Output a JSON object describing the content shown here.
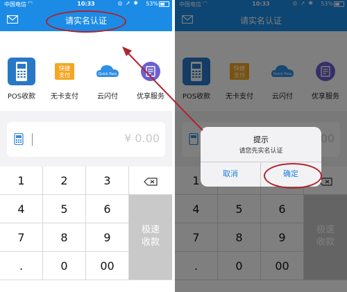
{
  "status_bar": {
    "carrier": "中国电信",
    "time": "10:33",
    "battery": "53%"
  },
  "nav": {
    "title": "请实名认证"
  },
  "tiles": [
    {
      "label": "POS收款",
      "icon": "pos-terminal-icon"
    },
    {
      "label": "无卡支付",
      "icon": "quick-pay-icon",
      "badge_line1": "快捷",
      "badge_line2": "支付"
    },
    {
      "label": "云闪付",
      "icon": "quickpass-cloud-icon",
      "badge_text": "Quick Pass"
    },
    {
      "label": "优享服务",
      "icon": "service-list-icon"
    }
  ],
  "amount": {
    "value": "¥ 0.00"
  },
  "keypad": {
    "keys": [
      "1",
      "2",
      "3",
      "4",
      "5",
      "6",
      "7",
      "8",
      "9",
      ".",
      "0",
      "00"
    ],
    "action_line1": "极速",
    "action_line2": "收款"
  },
  "dialog": {
    "title": "提示",
    "message": "请您先实名认证",
    "cancel": "取消",
    "confirm": "确定"
  },
  "colors": {
    "brand_blue": "#1b8be6",
    "annotation_red": "#b0222d",
    "dialog_button": "#1a7fe0"
  }
}
